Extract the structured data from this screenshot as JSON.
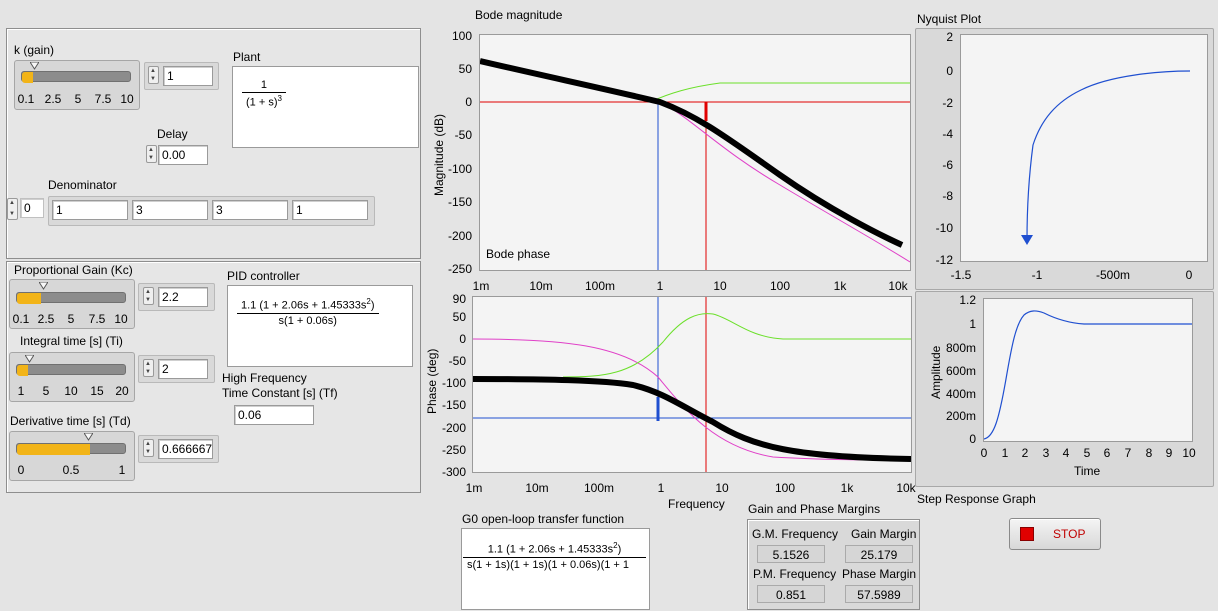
{
  "plant_panel": {
    "k_label": "k (gain)",
    "k_value": "1",
    "k_level": 0.1,
    "k_ticks": [
      "0.1",
      "2.5",
      "5",
      "7.5",
      "10"
    ],
    "plant_label": "Plant",
    "plant_num": "1",
    "plant_den": "(1 + s)",
    "plant_den_exp": "3",
    "delay_label": "Delay",
    "delay_value": "0.00",
    "denominator_label": "Denominator",
    "denominator_index": "0",
    "denominator_values": [
      "1",
      "3",
      "3",
      "1"
    ]
  },
  "pid_panel": {
    "kc_label": "Proportional Gain (Kc)",
    "kc_value": "2.2",
    "kc_level": 0.22,
    "kc_ticks": [
      "0.1",
      "2.5",
      "5",
      "7.5",
      "10"
    ],
    "pid_label": "PID controller",
    "pid_num": "1.1 (1 + 2.06s + 1.45333s",
    "pid_num_exp": "2",
    "pid_num_end": ")",
    "pid_den": "s(1 + 0.06s)",
    "ti_label": "Integral time [s] (Ti)",
    "ti_value": "2",
    "ti_level": 0.1,
    "ti_ticks": [
      "1",
      "5",
      "10",
      "15",
      "20"
    ],
    "td_label": "Derivative time [s] (Td)",
    "td_value": "0.666667",
    "td_level": 0.667,
    "td_ticks": [
      "0",
      "0.5",
      "1"
    ],
    "tf_label_1": "High Frequency",
    "tf_label_2": "Time Constant [s] (Tf)",
    "tf_value": "0.06"
  },
  "bode_mag": {
    "title": "Bode magnitude",
    "ylabel": "Magnitude (dB)",
    "overlay_label": "Bode phase",
    "yticks": [
      "100",
      "50",
      "0",
      "-50",
      "-100",
      "-150",
      "-200",
      "-250"
    ],
    "xticks": [
      "1m",
      "10m",
      "100m",
      "1",
      "10",
      "100",
      "1k",
      "10k"
    ]
  },
  "bode_phase": {
    "ylabel": "Phase (deg)",
    "xlabel": "Frequency",
    "yticks": [
      "90",
      "50",
      "0",
      "-50",
      "-100",
      "-150",
      "-200",
      "-250",
      "-300"
    ],
    "xticks": [
      "1m",
      "10m",
      "100m",
      "1",
      "10",
      "100",
      "1k",
      "10k"
    ]
  },
  "nyquist": {
    "title": "Nyquist Plot",
    "yticks": [
      "2",
      "0",
      "-2",
      "-4",
      "-6",
      "-8",
      "-10",
      "-12"
    ],
    "xticks": [
      "-1.5",
      "-1",
      "-500m",
      "0"
    ]
  },
  "step": {
    "title": "Step Response Graph",
    "ylabel": "Amplitude",
    "xlabel": "Time",
    "yticks": [
      "1.2",
      "1",
      "800m",
      "600m",
      "400m",
      "200m",
      "0"
    ],
    "xticks": [
      "0",
      "1",
      "2",
      "3",
      "4",
      "5",
      "6",
      "7",
      "8",
      "9",
      "10"
    ]
  },
  "g0": {
    "label": "G0 open-loop transfer function",
    "num": "1.1 (1 + 2.06s + 1.45333s",
    "num_exp": "2",
    "num_end": ")",
    "den": "s(1 + 1s)(1 + 1s)(1 + 0.06s)(1 + 1"
  },
  "margins": {
    "title": "Gain and Phase Margins",
    "gm_freq_label": "G.M. Frequency",
    "gm_freq_value": "5.1526",
    "gain_margin_label": "Gain Margin",
    "gain_margin_value": "25.179",
    "pm_freq_label": "P.M. Frequency",
    "pm_freq_value": "0.851",
    "phase_margin_label": "Phase Margin",
    "phase_margin_value": "57.5989"
  },
  "stop_button": {
    "label": "STOP"
  },
  "colors": {
    "slider_fill": "#f2b418",
    "black_curve": "#000000",
    "green_curve": "#6be02a",
    "magenta_curve": "#e040c8",
    "blue_curve": "#1f4fd0",
    "red_marker": "#e00000",
    "stop_red": "#e00000"
  }
}
